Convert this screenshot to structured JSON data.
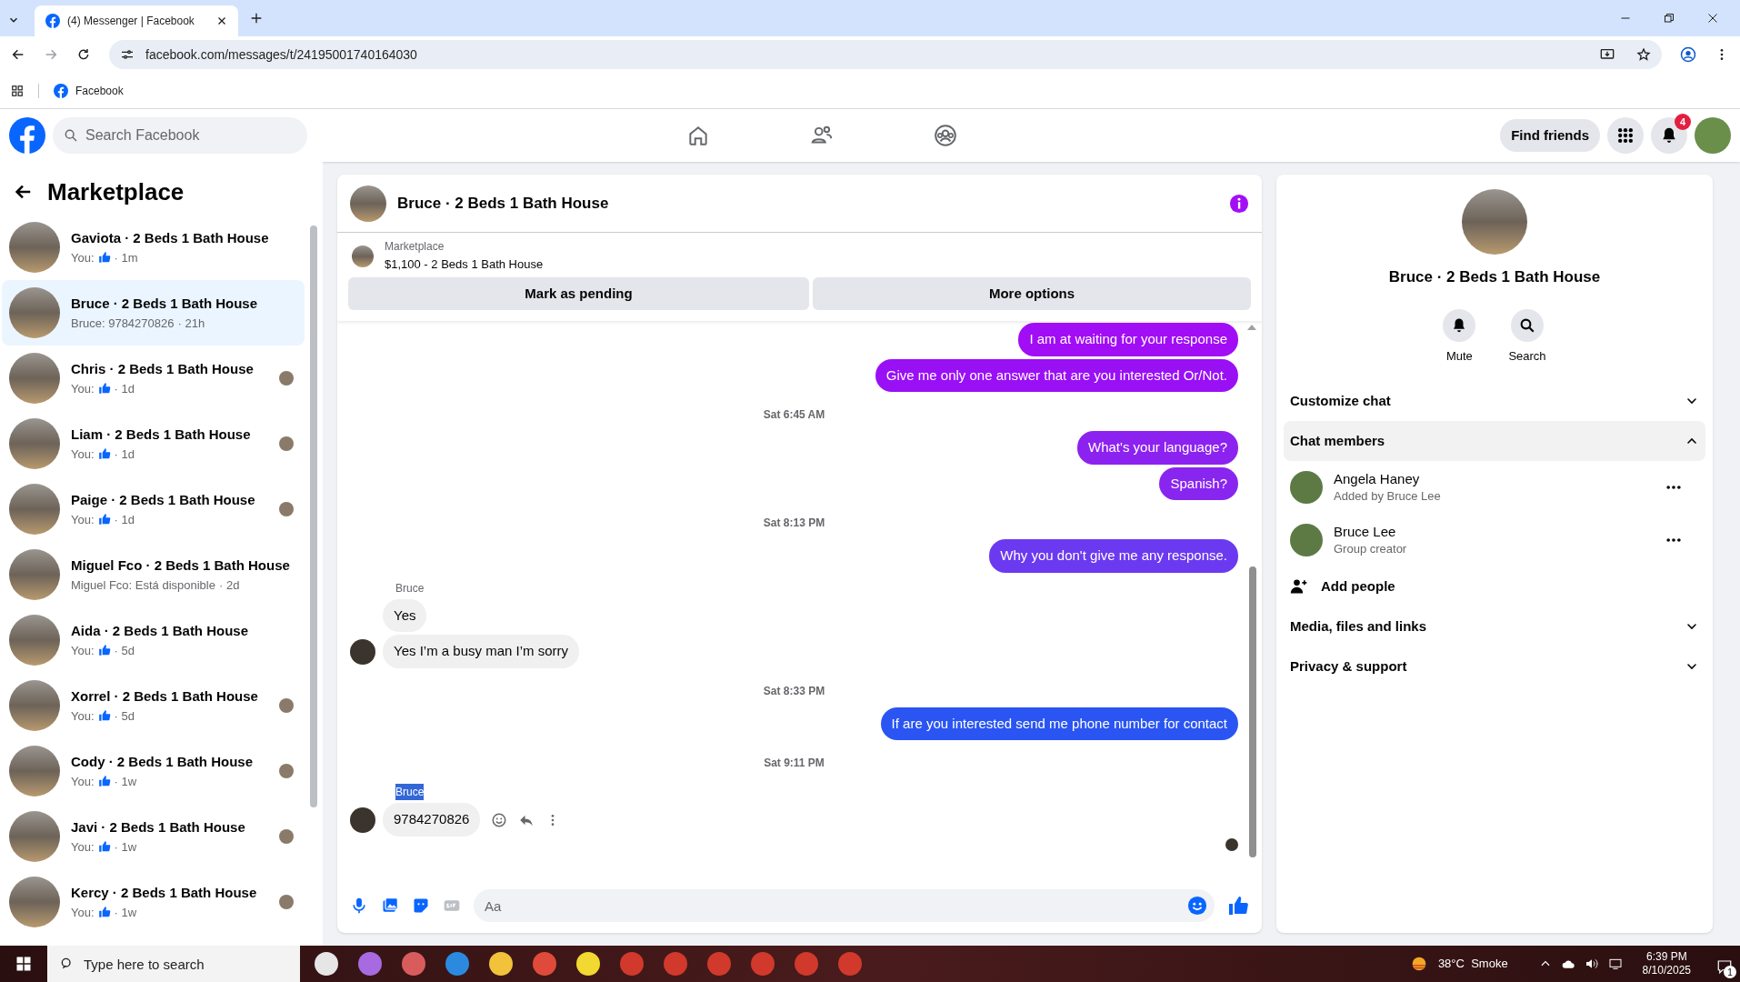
{
  "browser": {
    "tab_title": "(4) Messenger | Facebook",
    "url": "facebook.com/messages/t/24195001740164030",
    "bookmarks": [
      "Facebook"
    ]
  },
  "header": {
    "search_placeholder": "Search Facebook",
    "find_friends": "Find friends",
    "notification_count": "4"
  },
  "sidebar": {
    "title": "Marketplace",
    "items": [
      {
        "title": "Gaviota · 2 Beds 1 Bath House",
        "prefix": "You:",
        "liked": true,
        "time": "· 1m",
        "selected": false,
        "seen": false
      },
      {
        "title": "Bruce · 2 Beds 1 Bath House",
        "prefix": "Bruce: 9784270826",
        "liked": false,
        "time": "· 21h",
        "selected": true,
        "seen": false
      },
      {
        "title": "Chris · 2 Beds 1 Bath House",
        "prefix": "You:",
        "liked": true,
        "time": "· 1d",
        "selected": false,
        "seen": true
      },
      {
        "title": "Liam · 2 Beds 1 Bath House",
        "prefix": "You:",
        "liked": true,
        "time": "· 1d",
        "selected": false,
        "seen": true
      },
      {
        "title": "Paige · 2 Beds 1 Bath House",
        "prefix": "You:",
        "liked": true,
        "time": "· 1d",
        "selected": false,
        "seen": true
      },
      {
        "title": "Miguel Fco · 2 Beds 1 Bath House",
        "prefix": "Miguel Fco: Está disponible",
        "liked": false,
        "time": "· 2d",
        "selected": false,
        "seen": false
      },
      {
        "title": "Aida · 2 Beds 1 Bath House",
        "prefix": "You:",
        "liked": true,
        "time": "· 5d",
        "selected": false,
        "seen": false
      },
      {
        "title": "Xorrel · 2 Beds 1 Bath House",
        "prefix": "You:",
        "liked": true,
        "time": "· 5d",
        "selected": false,
        "seen": true
      },
      {
        "title": "Cody · 2 Beds 1 Bath House",
        "prefix": "You:",
        "liked": true,
        "time": "· 1w",
        "selected": false,
        "seen": true
      },
      {
        "title": "Javi · 2 Beds 1 Bath House",
        "prefix": "You:",
        "liked": true,
        "time": "· 1w",
        "selected": false,
        "seen": true
      },
      {
        "title": "Kercy · 2 Beds 1 Bath House",
        "prefix": "You:",
        "liked": true,
        "time": "· 1w",
        "selected": false,
        "seen": true
      }
    ]
  },
  "chat": {
    "title": "Bruce · 2 Beds 1 Bath House",
    "listing_label": "Marketplace",
    "listing": "$1,100 - 2 Beds 1 Bath House",
    "buttons": [
      "Mark as pending",
      "More options"
    ],
    "messages": [
      {
        "kind": "sent",
        "text": "I am at waiting for your response",
        "color": "#a10df5"
      },
      {
        "kind": "sent",
        "text": "Give me only one answer that are you interested Or/Not.",
        "color": "#9a10f5"
      },
      {
        "kind": "time",
        "text": "Sat 6:45 AM"
      },
      {
        "kind": "sent",
        "text": "What's your language?",
        "color": "#8c22f0"
      },
      {
        "kind": "sent",
        "text": "Spanish?",
        "color": "#8826f0"
      },
      {
        "kind": "time",
        "text": "Sat 8:13 PM"
      },
      {
        "kind": "sent",
        "text": "Why you don't give me any response.",
        "color": "#6b3af0"
      },
      {
        "kind": "sender",
        "text": "Bruce",
        "highlighted": false
      },
      {
        "kind": "received",
        "text": "Yes",
        "avatar": false,
        "hovered": false
      },
      {
        "kind": "received",
        "text": "Yes I’m a busy man I’m sorry",
        "avatar": true,
        "hovered": false
      },
      {
        "kind": "time",
        "text": "Sat 8:33 PM"
      },
      {
        "kind": "sent",
        "text": "If are you interested send me phone number for contact",
        "color": "#2a55f2"
      },
      {
        "kind": "time",
        "text": "Sat 9:11 PM"
      },
      {
        "kind": "sender",
        "text": "Bruce",
        "highlighted": true
      },
      {
        "kind": "received",
        "text": "9784270826",
        "avatar": true,
        "hovered": true
      },
      {
        "kind": "seen"
      }
    ],
    "composer_placeholder": "Aa"
  },
  "details": {
    "title": "Bruce · 2 Beds 1 Bath House",
    "actions": [
      "Mute",
      "Search"
    ],
    "sections": [
      {
        "label": "Customize chat",
        "expanded": false
      },
      {
        "label": "Chat members",
        "expanded": true
      },
      {
        "label": "Media, files and links",
        "expanded": false
      },
      {
        "label": "Privacy & support",
        "expanded": false
      }
    ],
    "members": [
      {
        "name": "Angela Haney",
        "role": "Added by Bruce Lee"
      },
      {
        "name": "Bruce Lee",
        "role": "Group creator"
      }
    ],
    "add_people": "Add people"
  },
  "taskbar": {
    "search_placeholder": "Type here to search",
    "weather": "38°C  Smoke",
    "time": "6:39 PM",
    "date": "8/10/2025",
    "notifications": "1"
  }
}
